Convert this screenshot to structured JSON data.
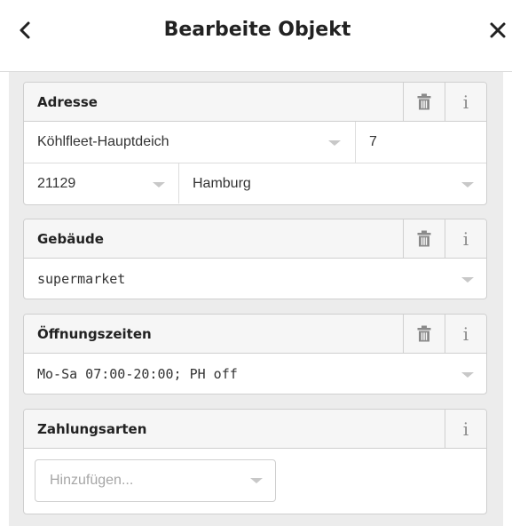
{
  "header": {
    "title": "Bearbeite Objekt",
    "back_icon": "chevron-left-icon",
    "close_icon": "close-icon"
  },
  "fields": {
    "address": {
      "label": "Adresse",
      "street": "Köhlfleet-Hauptdeich",
      "housenumber": "7",
      "postcode": "21129",
      "city": "Hamburg"
    },
    "building": {
      "label": "Gebäude",
      "value": "supermarket"
    },
    "opening_hours": {
      "label": "Öffnungszeiten",
      "value": "Mo-Sa 07:00-20:00; PH off"
    },
    "payment": {
      "label": "Zahlungsarten",
      "placeholder": "Hinzufügen..."
    }
  },
  "icons": {
    "info_glyph": "i",
    "trash": "trash-icon",
    "dropdown": "chevron-down-icon"
  },
  "colors": {
    "panel_background": "#ececec",
    "field_header": "#f6f6f6",
    "border": "#cfcfcf",
    "icon_gray": "#8a8a8a"
  }
}
